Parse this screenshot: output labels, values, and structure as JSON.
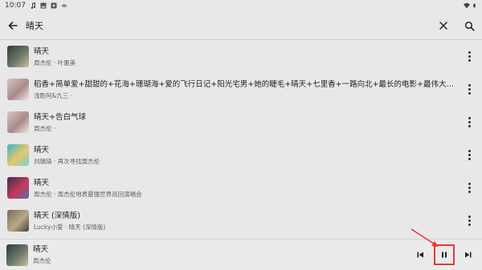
{
  "status_bar": {
    "time": "10:07"
  },
  "search": {
    "query": "晴天",
    "back_icon": "arrow-back-icon",
    "clear_icon": "close-icon",
    "search_icon": "search-icon"
  },
  "results": [
    {
      "title": "晴天",
      "subtitle": "周杰伦 · 叶惠美",
      "thumb_colors": [
        "#2f3a3a",
        "#6b7a6a",
        "#c9c0a0"
      ]
    },
    {
      "title": "稻香+简单爱+甜甜的+花海+珊瑚海+爱的飞行日记+阳光宅男+她的睫毛+晴天+七里香+一路向北+最长的电影+最伟大的作品+…",
      "subtitle": "浅影阿&九三 ·",
      "thumb_colors": [
        "#d8c7c4",
        "#a98a8a",
        "#f0e4e0"
      ]
    },
    {
      "title": "晴天+告白气球",
      "subtitle": "周杰伦 ·",
      "thumb_colors": [
        "#d8c7c4",
        "#a98a8a",
        "#f0e4e0"
      ]
    },
    {
      "title": "晴天",
      "subtitle": "刘瑞琦 · 再次寻找周杰伦",
      "thumb_colors": [
        "#3ab6c8",
        "#e7c76a",
        "#6fd0df"
      ]
    },
    {
      "title": "晴天",
      "subtitle": "周杰伦 · 周杰伦地表最强世界巡回演唱会",
      "thumb_colors": [
        "#3a2f4d",
        "#c23a5a",
        "#5a6fae"
      ]
    },
    {
      "title": "晴天 (深情版)",
      "subtitle": "Lucky小爱 · 晴天 (深情版)",
      "thumb_colors": [
        "#7a6a55",
        "#b8a98a",
        "#4a3f33"
      ]
    }
  ],
  "player": {
    "title": "晴天",
    "subtitle": "周杰伦",
    "thumb_colors": [
      "#2f3a3a",
      "#6b7a6a",
      "#c9c0a0"
    ],
    "prev_icon": "skip-previous-icon",
    "pause_icon": "pause-icon",
    "next_icon": "skip-next-icon",
    "highlight_color": "#e53935"
  }
}
